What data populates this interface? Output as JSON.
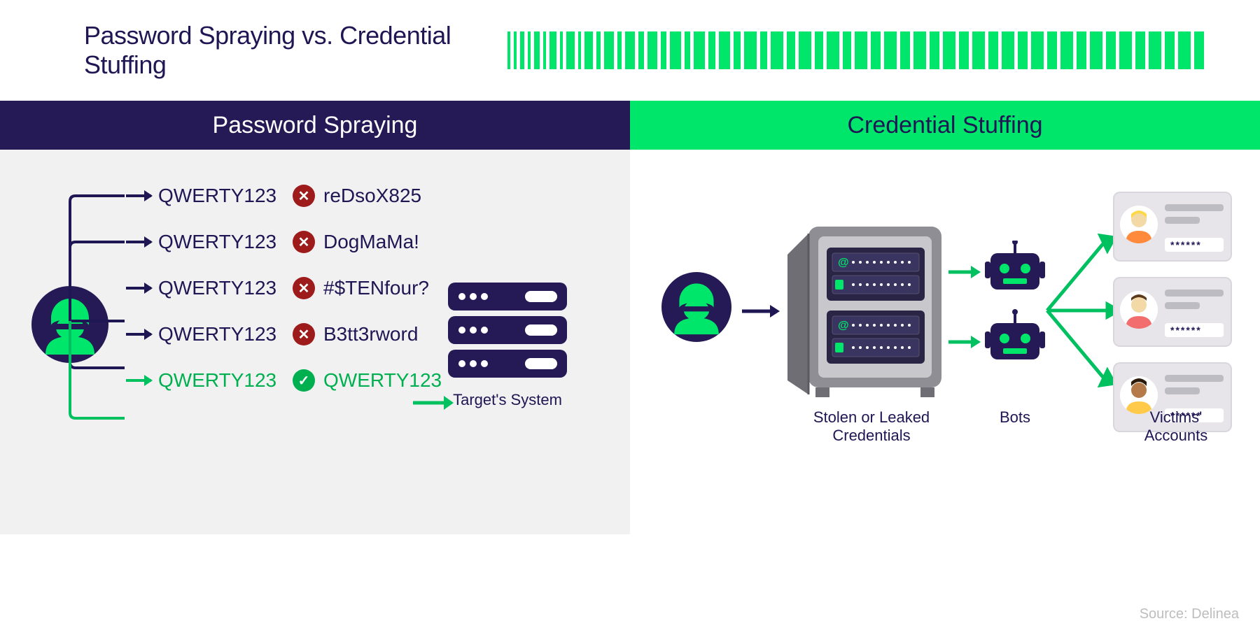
{
  "title": "Password Spraying vs. Credential Stuffing",
  "left": {
    "header": "Password Spraying",
    "attempts": [
      {
        "guess": "QWERTY123",
        "actual": "reDsoX825",
        "ok": false
      },
      {
        "guess": "QWERTY123",
        "actual": "DogMaMa!",
        "ok": false
      },
      {
        "guess": "QWERTY123",
        "actual": "#$TENfour?",
        "ok": false
      },
      {
        "guess": "QWERTY123",
        "actual": "B3tt3rword",
        "ok": false
      },
      {
        "guess": "QWERTY123",
        "actual": "QWERTY123",
        "ok": true
      }
    ],
    "target_label": "Target's System"
  },
  "right": {
    "header": "Credential Stuffing",
    "safe_label": "Stolen or Leaked Credentials",
    "bots_label": "Bots",
    "victims_label": "Victims' Accounts",
    "card_pw": "******"
  },
  "source": "Source: Delinea",
  "colors": {
    "navy": "#251a56",
    "green": "#00e66b",
    "success": "#00b050",
    "fail": "#9e1b1b"
  }
}
